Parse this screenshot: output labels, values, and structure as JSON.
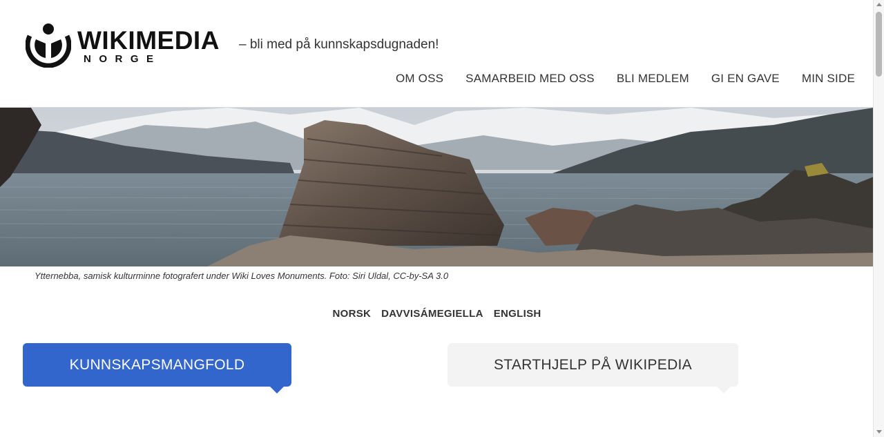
{
  "header": {
    "logo_word": "WIKIMEDIA",
    "logo_sub": "NORGE",
    "tagline": "– bli med på kunnskapsdugnaden!"
  },
  "nav": [
    "OM OSS",
    "SAMARBEID MED OSS",
    "BLI MEDLEM",
    "GI EN GAVE",
    "MIN SIDE"
  ],
  "hero": {
    "caption": "Ytternebba, samisk kulturminne fotografert under Wiki Loves Monuments. Foto: Siri Uldal, CC-by-SA 3.0"
  },
  "languages": [
    "NORSK",
    "DAVVISÁMEGIELLA",
    "ENGLISH"
  ],
  "tabs": {
    "primary": "KUNNSKAPSMANGFOLD",
    "secondary": "STARTHJELP PÅ WIKIPEDIA"
  },
  "colors": {
    "accent": "#3366cc",
    "tab_inactive": "#f3f3f3"
  }
}
